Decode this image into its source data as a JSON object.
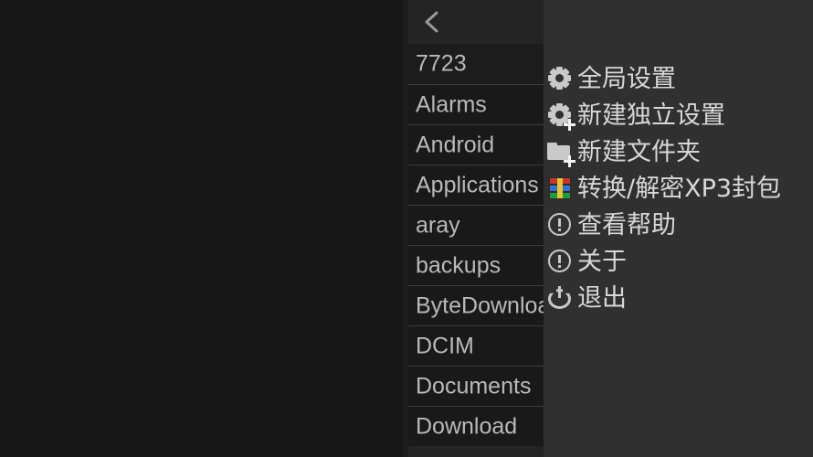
{
  "file_panel": {
    "back_icon": "chevron-left-icon",
    "items": [
      {
        "label": "7723"
      },
      {
        "label": "Alarms"
      },
      {
        "label": "Android"
      },
      {
        "label": "Applications"
      },
      {
        "label": "aray"
      },
      {
        "label": "backups"
      },
      {
        "label": "ByteDownload"
      },
      {
        "label": "DCIM"
      },
      {
        "label": "Documents"
      },
      {
        "label": "Download"
      }
    ]
  },
  "menu": {
    "items": [
      {
        "label": "全局设置",
        "icon": "gear-icon"
      },
      {
        "label": "新建独立设置",
        "icon": "gear-plus-icon"
      },
      {
        "label": "新建文件夹",
        "icon": "folder-plus-icon"
      },
      {
        "label": "转换/解密XP3封包",
        "icon": "archive-icon"
      },
      {
        "label": "查看帮助",
        "icon": "info-circle-icon"
      },
      {
        "label": "关于",
        "icon": "info-circle-icon"
      },
      {
        "label": "退出",
        "icon": "power-icon"
      }
    ]
  },
  "colors": {
    "content_background": "#171717",
    "file_panel_background": "#242424",
    "file_row_background": "#191919",
    "menu_background": "#303030",
    "text": "#d8d8d8",
    "file_text": "#b9b9b9",
    "archive_red": "#c0392b",
    "archive_blue": "#3d6fd0",
    "archive_green": "#1f9b3f",
    "archive_yellow": "#e8c33a"
  }
}
